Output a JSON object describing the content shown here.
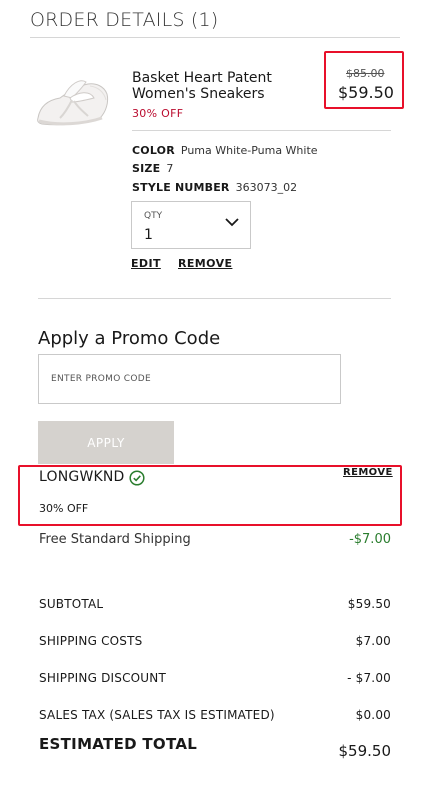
{
  "header": {
    "title": "ORDER DETAILS (1)"
  },
  "product": {
    "name": "Basket Heart Patent Women's Sneakers",
    "discount_label": "30% OFF",
    "price_original": "$85.00",
    "price_sale": "$59.50",
    "specs": [
      {
        "key": "COLOR",
        "value": "Puma White-Puma White"
      },
      {
        "key": "SIZE",
        "value": "7"
      },
      {
        "key": "STYLE NUMBER",
        "value": "363073_02"
      }
    ],
    "qty_label": "QTY",
    "qty_value": "1",
    "edit_label": "EDIT",
    "remove_label": "REMOVE"
  },
  "promo": {
    "title": "Apply a Promo Code",
    "placeholder": "ENTER PROMO CODE",
    "apply_label": "APPLY",
    "applied_code": "LONGWKND",
    "applied_remove_label": "REMOVE",
    "applied_discount": "30% OFF"
  },
  "shipping_promo": {
    "label": "Free Standard Shipping",
    "value": "-$7.00"
  },
  "summary": {
    "rows": [
      {
        "label": "SUBTOTAL",
        "value": "$59.50"
      },
      {
        "label": "SHIPPING COSTS",
        "value": "$7.00"
      },
      {
        "label": "SHIPPING DISCOUNT",
        "value": "- $7.00"
      },
      {
        "label": "SALES TAX (SALES TAX IS ESTIMATED)",
        "value": "$0.00"
      }
    ],
    "total_label": "ESTIMATED TOTAL",
    "total_value": "$59.50"
  },
  "colors": {
    "sale_red": "#ba0c2f",
    "highlight_red": "#e8102a",
    "discount_green": "#2a7d2e",
    "button_disabled": "#d5d2ce"
  },
  "icons": {
    "qty": "chevron-down-icon",
    "promo_status": "check-circle-icon"
  }
}
